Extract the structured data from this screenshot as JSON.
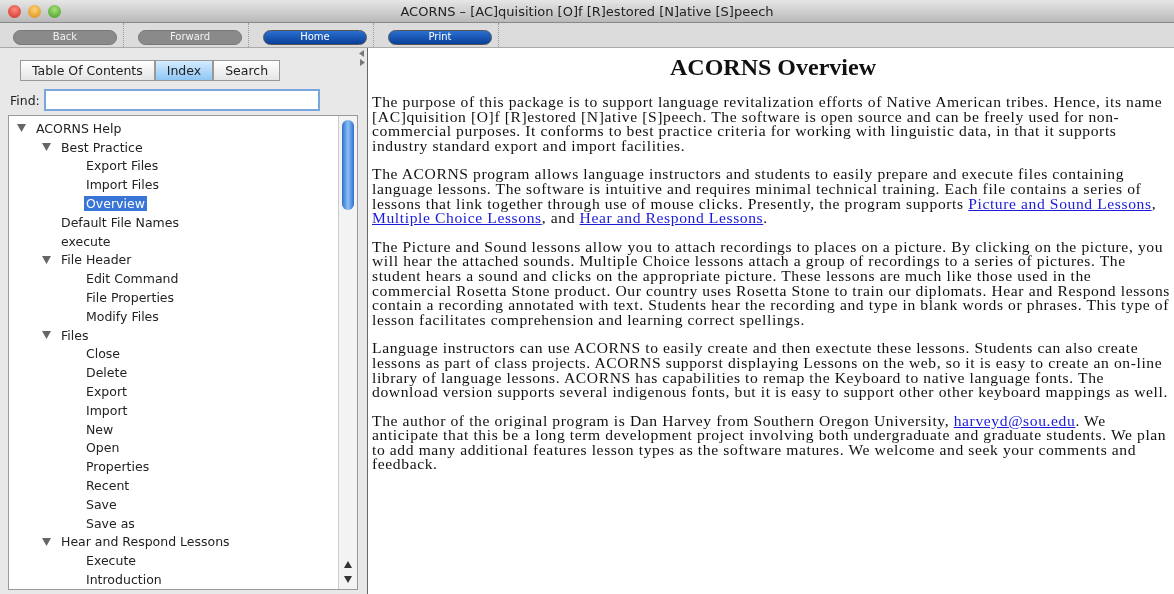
{
  "window": {
    "title": "ACORNS – [AC]quisition [O]f [R]estored [N]ative [S]peech"
  },
  "toolbar": [
    {
      "label": "Back",
      "disabled": true
    },
    {
      "label": "Forward",
      "disabled": true
    },
    {
      "label": "Home",
      "disabled": false
    },
    {
      "label": "Print",
      "disabled": false
    }
  ],
  "tabs": [
    {
      "label": "Table Of Contents",
      "selected": false
    },
    {
      "label": "Index",
      "selected": true
    },
    {
      "label": "Search",
      "selected": false
    }
  ],
  "find": {
    "label": "Find:"
  },
  "tree": [
    {
      "label": "ACORNS Help",
      "expanded": true,
      "selected": false,
      "children": [
        {
          "label": "Best Practice",
          "expanded": true,
          "selected": false,
          "children": [
            {
              "label": "Export Files",
              "selected": false
            },
            {
              "label": "Import Files",
              "selected": false
            },
            {
              "label": "Overview",
              "selected": true
            }
          ]
        },
        {
          "label": "Default File Names",
          "selected": false
        },
        {
          "label": "execute",
          "selected": false
        },
        {
          "label": "File Header",
          "expanded": true,
          "selected": false,
          "children": [
            {
              "label": "Edit Command",
              "selected": false
            },
            {
              "label": "File Properties",
              "selected": false
            },
            {
              "label": "Modify Files",
              "selected": false
            }
          ]
        },
        {
          "label": "Files",
          "expanded": true,
          "selected": false,
          "children": [
            {
              "label": "Close",
              "selected": false
            },
            {
              "label": "Delete",
              "selected": false
            },
            {
              "label": "Export",
              "selected": false
            },
            {
              "label": "Import",
              "selected": false
            },
            {
              "label": "New",
              "selected": false
            },
            {
              "label": "Open",
              "selected": false
            },
            {
              "label": "Properties",
              "selected": false
            },
            {
              "label": "Recent",
              "selected": false
            },
            {
              "label": "Save",
              "selected": false
            },
            {
              "label": "Save as",
              "selected": false
            }
          ]
        },
        {
          "label": "Hear and Respond Lessons",
          "expanded": true,
          "selected": false,
          "children": [
            {
              "label": "Execute",
              "selected": false
            },
            {
              "label": "Introduction",
              "selected": false
            }
          ]
        }
      ]
    }
  ],
  "content": {
    "heading": "ACORNS Overview",
    "paragraphs": [
      [
        {
          "kind": "text",
          "text": "The purpose of this package is to support language revitalization efforts of Native American tribes. Hence, its name [AC]quisition [O]f [R]estored [N]ative [S]peech. The software is open source and can be freely used for non-commercial purposes. It conforms to best practice criteria for working with linguistic data, in that it supports industry standard export and import facilities."
        }
      ],
      [
        {
          "kind": "text",
          "text": "The ACORNS program allows language instructors and students to easily prepare and execute files containing language lessons. The software is intuitive and requires minimal technical training. Each file contains a series of lessons that link together through use of mouse clicks. Presently, the program supports "
        },
        {
          "kind": "link",
          "text": "Picture and Sound Lessons"
        },
        {
          "kind": "text",
          "text": ", "
        },
        {
          "kind": "link",
          "text": "Multiple Choice Lessons"
        },
        {
          "kind": "text",
          "text": ", and "
        },
        {
          "kind": "link",
          "text": "Hear and Respond Lessons"
        },
        {
          "kind": "text",
          "text": "."
        }
      ],
      [
        {
          "kind": "text",
          "text": "The Picture and Sound lessons allow you to attach recordings to places on a picture. By clicking on the picture, you will hear the attached sounds. Multiple Choice lessons attach a group of recordings to a series of pictures. The student hears a sound and clicks on the appropriate picture. These lessons are much like those used in the commercial Rosetta Stone product. Our country uses Rosetta Stone to train our diplomats. Hear and Respond lessons contain a recording annotated with text. Students hear the recording and type in blank words or phrases. This type of lesson facilitates comprehension and learning correct spellings."
        }
      ],
      [
        {
          "kind": "text",
          "text": "Language instructors can use ACORNS to easily create and then exectute these lessons. Students can also create lessons as part of class projects. ACORNS supporst displaying Lessons on the web, so it is easy to create an on-line library of language lessons. ACORNS has capabilities to remap the Keyboard to native language fonts. The download version supports several indigenous fonts, but it is easy to support other other keyboard mappings as well."
        }
      ],
      [
        {
          "kind": "text",
          "text": "The author of the original program is Dan Harvey from Southern Oregon University, "
        },
        {
          "kind": "link",
          "text": "harveyd@sou.edu"
        },
        {
          "kind": "text",
          "text": ". We anticipate that this be a long term development project involving both undergraduate and graduate students. We plan to add many additional features lesson types as the software matures. We welcome and seek your comments and feedback."
        }
      ]
    ]
  }
}
